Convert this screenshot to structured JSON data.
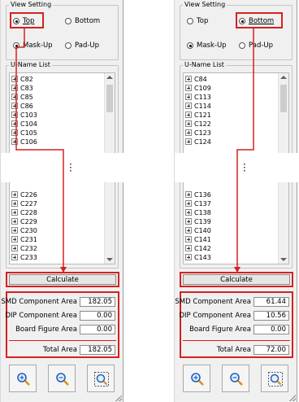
{
  "left": {
    "view_setting": {
      "title": "View Setting",
      "side_top": "Top",
      "side_bottom": "Bottom",
      "side_selected": "Top",
      "mask_up": "Mask-Up",
      "pad_up": "Pad-Up",
      "layer_selected": "Mask-Up"
    },
    "u_name_list": {
      "title": "U-Name List",
      "items_top": [
        "C82",
        "C83",
        "C85",
        "C86",
        "C103",
        "C104",
        "C105",
        "C106"
      ],
      "items_bottom": [
        "C226",
        "C227",
        "C228",
        "C229",
        "C230",
        "C231",
        "C232",
        "C233"
      ]
    },
    "calculate_label": "Calculate",
    "areas": {
      "smd_label": "SMD Component Area",
      "smd_value": "182.05",
      "dip_label": "DIP Component Area",
      "dip_value": "0.00",
      "board_label": "Board Figure Area",
      "board_value": "0.00",
      "total_label": "Total Area",
      "total_value": "182.05"
    }
  },
  "right": {
    "view_setting": {
      "title": "View Setting",
      "side_top": "Top",
      "side_bottom": "Bottom",
      "side_selected": "Bottom",
      "mask_up": "Mask-Up",
      "pad_up": "Pad-Up",
      "layer_selected": "Mask-Up"
    },
    "u_name_list": {
      "title": "U-Name List",
      "items_top": [
        "C84",
        "C109",
        "C113",
        "C114",
        "C121",
        "C122",
        "C123",
        "C124"
      ],
      "items_bottom": [
        "C136",
        "C137",
        "C138",
        "C139",
        "C140",
        "C141",
        "C142",
        "C143"
      ]
    },
    "calculate_label": "Calculate",
    "areas": {
      "smd_label": "SMD Component Area",
      "smd_value": "61.44",
      "dip_label": "DIP Component Area",
      "dip_value": "10.56",
      "board_label": "Board Figure Area",
      "board_value": "0.00",
      "total_label": "Total Area",
      "total_value": "72.00"
    }
  },
  "icons": [
    "zoom-in-icon",
    "zoom-out-icon",
    "zoom-fit-icon"
  ],
  "colors": {
    "highlight": "#d62020",
    "icon_blue": "#1f5fbf",
    "icon_orange": "#e08a1a"
  }
}
